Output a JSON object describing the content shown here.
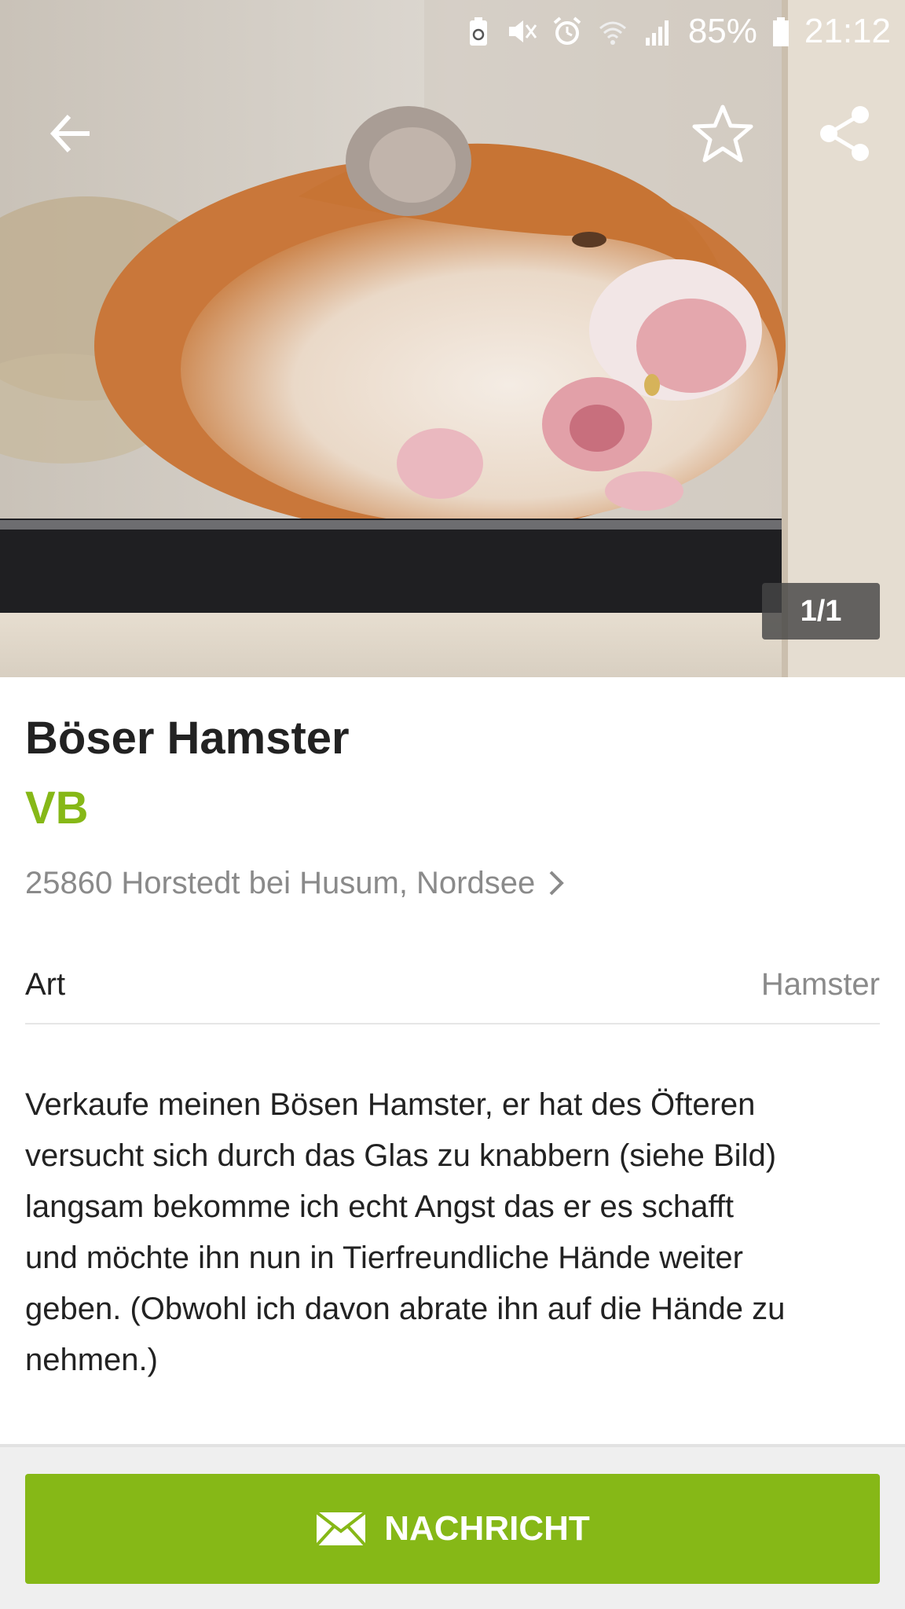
{
  "status_bar": {
    "battery_percent": "85%",
    "time": "21:12",
    "icons": [
      "battery-saver-icon",
      "mute-icon",
      "alarm-icon",
      "wifi-icon",
      "signal-icon",
      "battery-icon"
    ]
  },
  "toolbar": {
    "back_icon": "arrow-left-icon",
    "favorite_icon": "star-outline-icon",
    "share_icon": "share-icon"
  },
  "gallery": {
    "counter": "1/1"
  },
  "listing": {
    "title": "Böser Hamster",
    "price": "VB",
    "location": "25860 Horstedt bei Husum, Nordsee",
    "attributes": [
      {
        "label": "Art",
        "value": "Hamster"
      }
    ],
    "description_lines": [
      "Verkaufe meinen Bösen Hamster, er hat des Öfteren",
      "versucht sich durch das Glas zu knabbern (siehe Bild)",
      "langsam bekomme ich echt Angst das er es schafft",
      "und möchte ihn nun in Tierfreundliche Hände weiter",
      "geben. (Obwohl ich davon abrate ihn auf die Hände zu",
      "nehmen.)"
    ]
  },
  "action": {
    "message_label": "NACHRICHT",
    "message_icon": "envelope-icon"
  },
  "colors": {
    "accent_green": "#86b817",
    "secondary_text": "#8a8a8a",
    "primary_text": "#222222"
  }
}
